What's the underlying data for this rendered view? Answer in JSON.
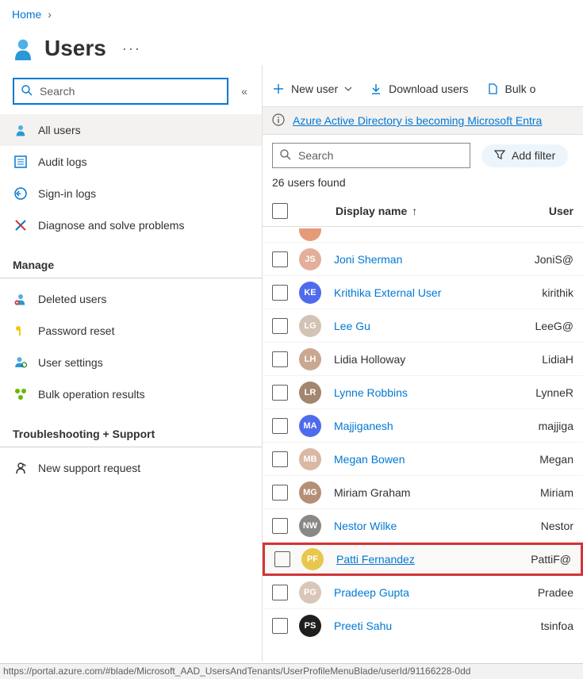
{
  "breadcrumbs": {
    "root": "Home"
  },
  "page_title": "Users",
  "sidebar": {
    "search_placeholder": "Search",
    "items": [
      {
        "label": "All users"
      },
      {
        "label": "Audit logs"
      },
      {
        "label": "Sign-in logs"
      },
      {
        "label": "Diagnose and solve problems"
      }
    ],
    "sections": [
      {
        "heading": "Manage",
        "items": [
          {
            "label": "Deleted users"
          },
          {
            "label": "Password reset"
          },
          {
            "label": "User settings"
          },
          {
            "label": "Bulk operation results"
          }
        ]
      },
      {
        "heading": "Troubleshooting + Support",
        "items": [
          {
            "label": "New support request"
          }
        ]
      }
    ]
  },
  "toolbar": {
    "new_user": "New user",
    "download_users": "Download users",
    "bulk": "Bulk o"
  },
  "notice": {
    "link": "Azure Active Directory is becoming Microsoft Entra"
  },
  "main": {
    "search_placeholder": "Search",
    "add_filter": "Add filter",
    "count_text": "26 users found",
    "columns": {
      "display_name": "Display name",
      "upn": "User"
    },
    "rows": [
      {
        "initials": "JS",
        "color": "#e3af9b",
        "name": "Joni Sherman",
        "upn": "JoniS@"
      },
      {
        "initials": "KE",
        "color": "#4f6bed",
        "name": "Krithika External User",
        "upn": "kirithik"
      },
      {
        "initials": "LG",
        "color": "#d2c3b5",
        "name": "Lee Gu",
        "upn": "LeeG@"
      },
      {
        "initials": "LH",
        "color": "#c9a892",
        "name": "Lidia Holloway",
        "upn": "LidiaH",
        "nolink": true
      },
      {
        "initials": "LR",
        "color": "#a28670",
        "name": "Lynne Robbins",
        "upn": "LynneR"
      },
      {
        "initials": "MA",
        "color": "#4f6bed",
        "name": "Majjiganesh",
        "upn": "majjiga"
      },
      {
        "initials": "MB",
        "color": "#d9b8a4",
        "name": "Megan Bowen",
        "upn": "Megan"
      },
      {
        "initials": "MG",
        "color": "#b58e76",
        "name": "Miriam Graham",
        "upn": "Miriam",
        "nolink": true
      },
      {
        "initials": "NW",
        "color": "#8a8886",
        "name": "Nestor Wilke",
        "upn": "Nestor"
      },
      {
        "initials": "PF",
        "color": "#e8c74e",
        "name": "Patti Fernandez",
        "upn": "PattiF@",
        "highlight": true
      },
      {
        "initials": "PG",
        "color": "#d9c6b8",
        "name": "Pradeep Gupta",
        "upn": "Pradee"
      },
      {
        "initials": "PS",
        "color": "#201f1e",
        "name": "Preeti Sahu",
        "upn": "tsinfoa"
      }
    ]
  },
  "status_url": "https://portal.azure.com/#blade/Microsoft_AAD_UsersAndTenants/UserProfileMenuBlade/userId/91166228-0dd"
}
